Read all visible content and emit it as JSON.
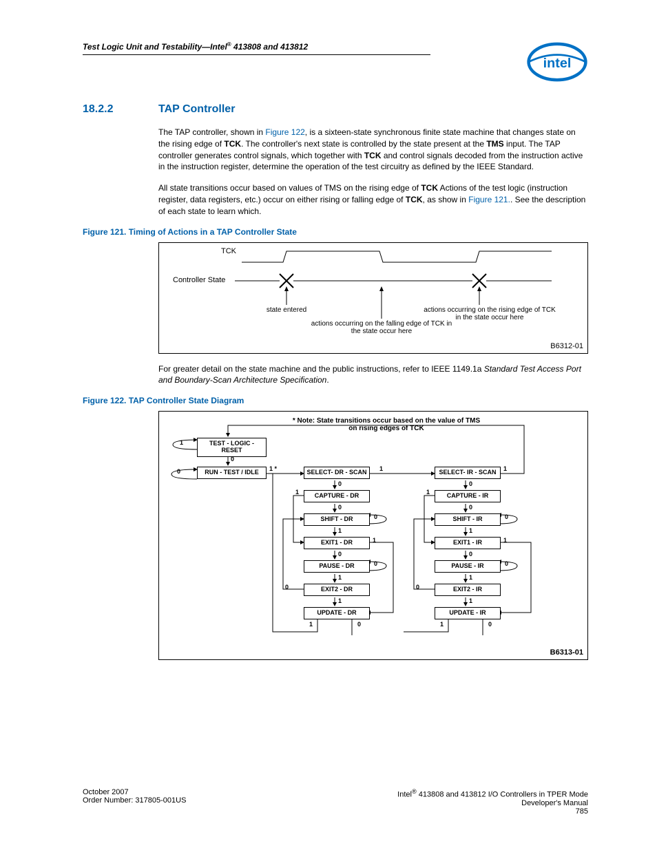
{
  "header": {
    "title_prefix": "Test Logic Unit and Testability—Intel",
    "title_suffix": " 413808 and 413812",
    "reg_mark": "®"
  },
  "section": {
    "number": "18.2.2",
    "title": "TAP Controller"
  },
  "para1": {
    "t1": "The TAP controller, shown in ",
    "link1": "Figure 122",
    "t2": ", is a sixteen-state synchronous finite state machine that changes state on the rising edge of ",
    "b1": "TCK",
    "t3": ". The controller's next state is controlled by the state present at the ",
    "b2": "TMS",
    "t4": " input. The TAP controller generates control signals, which together with ",
    "b3": "TCK",
    "t5": " and control signals decoded from the instruction active in the instruction register, determine the operation of the test circuitry as defined by the IEEE Standard."
  },
  "para2": {
    "t1": "All state transitions occur based on values of TMS on the rising edge of ",
    "b1": "TCK",
    "t2": " Actions of the test logic (instruction register, data registers, etc.) occur on either rising or falling edge of ",
    "b2": "TCK",
    "t3": ", as show in ",
    "link1": "Figure 121.",
    "t4": ". See the description of each state to learn which."
  },
  "fig121": {
    "caption": "Figure 121.  Timing of Actions in a TAP Controller State",
    "labels": {
      "tck": "TCK",
      "controller_state": "Controller State",
      "state_entered": "state entered",
      "falling": "actions occurring on the falling edge of TCK in the state occur here",
      "rising": "actions occurring on the rising edge of TCK in the state occur here"
    },
    "id": "B6312-01"
  },
  "para3": {
    "t1": "For greater detail on the state machine and the public instructions, refer to IEEE 1149.1a ",
    "i1": "Standard Test Access Port and Boundary-Scan Architecture Specification",
    "t2": "."
  },
  "fig122": {
    "caption": "Figure 122.  TAP Controller State Diagram",
    "note": "* Note: State transitions occur based on the value of TMS on rising edges of TCK",
    "states": {
      "tlr": "TEST - LOGIC - RESET",
      "rti": "RUN - TEST / IDLE",
      "sdr": "SELECT- DR - SCAN",
      "sir": "SELECT- IR - SCAN",
      "cdr": "CAPTURE - DR",
      "cir": "CAPTURE - IR",
      "shdr": "SHIFT - DR",
      "shir": "SHIFT - IR",
      "e1dr": "EXIT1 - DR",
      "e1ir": "EXIT1 - IR",
      "pdr": "PAUSE - DR",
      "pir": "PAUSE - IR",
      "e2dr": "EXIT2 - DR",
      "e2ir": "EXIT2 - IR",
      "udr": "UPDATE - DR",
      "uir": "UPDATE - IR"
    },
    "tms": {
      "zero": "0",
      "one": "1",
      "onestar": "1 *"
    },
    "id": "B6313-01"
  },
  "footer": {
    "left1": "October 2007",
    "left2": "Order Number: 317805-001US",
    "right1_prefix": "Intel",
    "right1_suffix": " 413808 and 413812 I/O Controllers in TPER Mode",
    "right2": "Developer's Manual",
    "right3": "785"
  }
}
